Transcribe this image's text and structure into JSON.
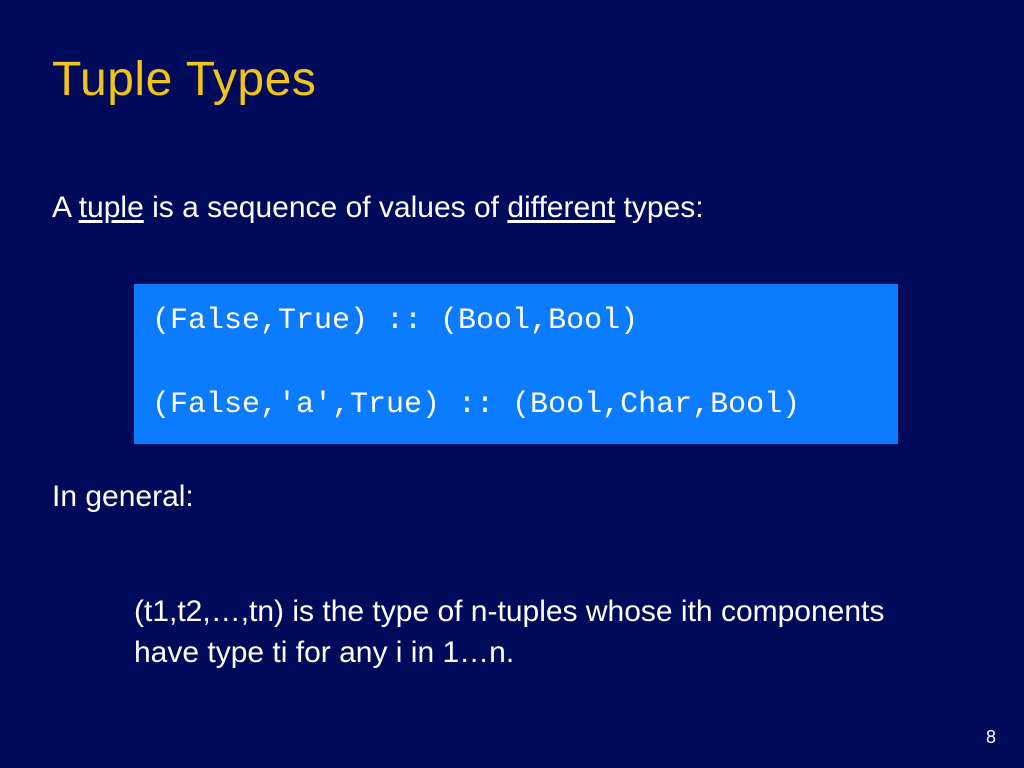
{
  "title": "Tuple Types",
  "intro": {
    "pre": "A ",
    "u1": "tuple",
    "mid": " is a sequence of values of ",
    "u2": "different",
    "post": " types:"
  },
  "code": {
    "line1": "(False,True) :: (Bool,Bool)",
    "blank": "",
    "line2": "(False,'a',True) :: (Bool,Char,Bool)"
  },
  "subhead": "In general:",
  "general": "(t1,t2,…,tn) is the type of n-tuples whose ith components have type ti for any i in 1…n.",
  "page": "8"
}
